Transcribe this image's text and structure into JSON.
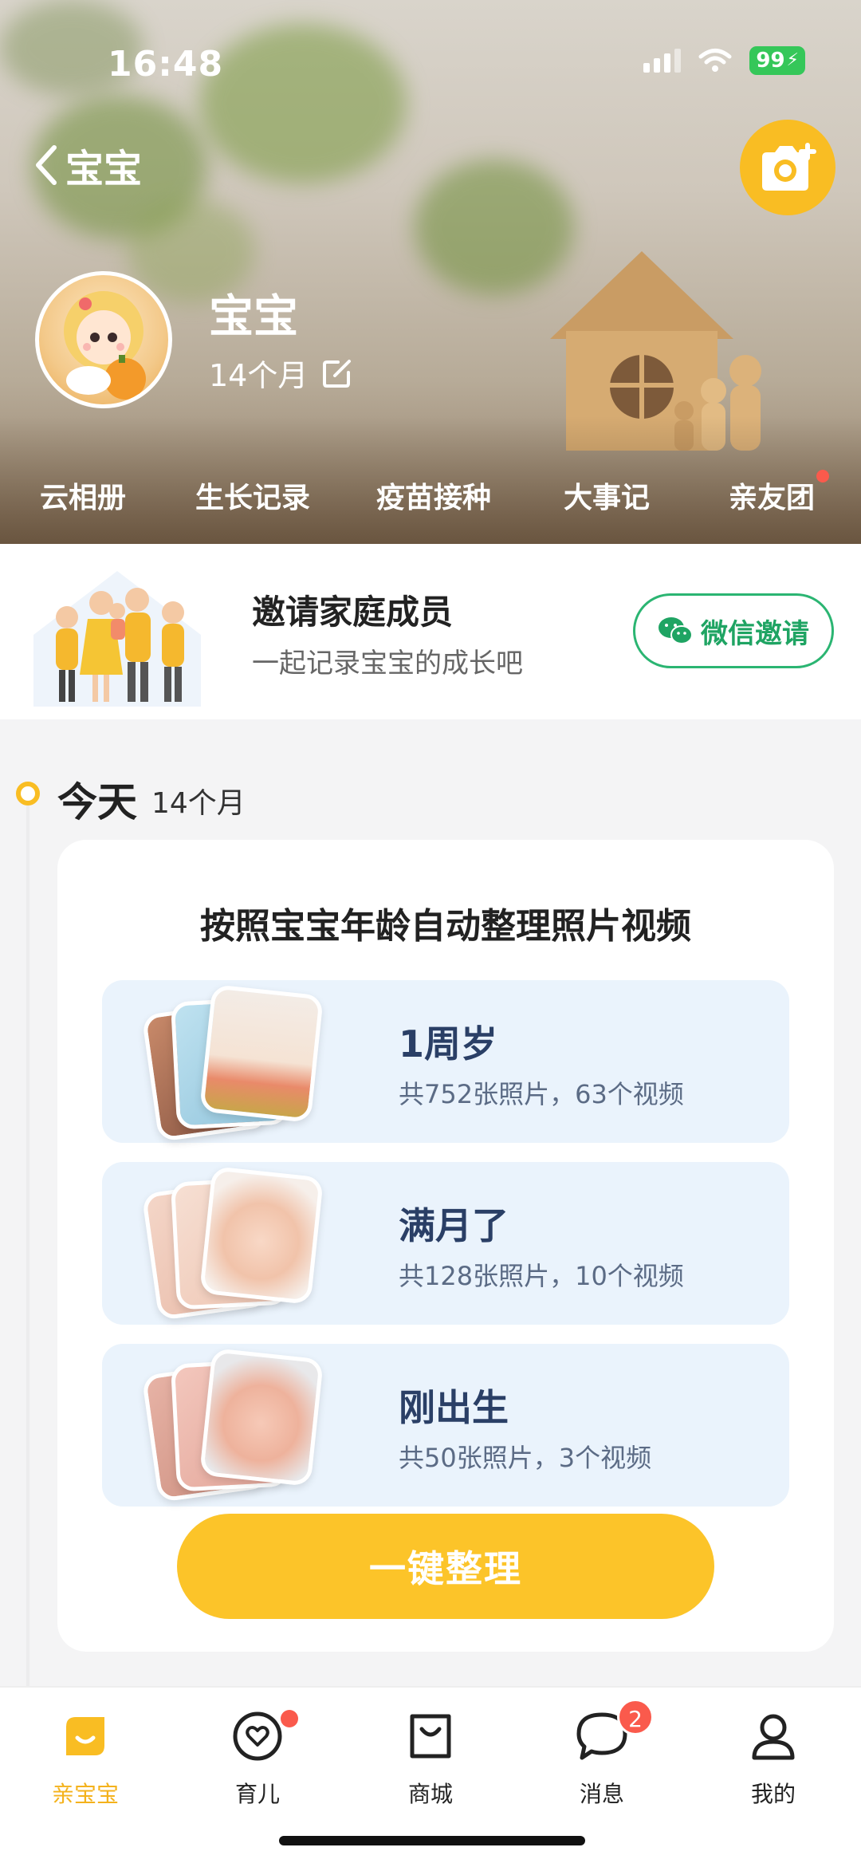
{
  "status_bar": {
    "time": "16:48",
    "battery": "99"
  },
  "header": {
    "back_label": "宝宝"
  },
  "profile": {
    "name": "宝宝",
    "age": "14个月"
  },
  "tabs": [
    "云相册",
    "生长记录",
    "疫苗接种",
    "大事记",
    "亲友团"
  ],
  "invite": {
    "title": "邀请家庭成员",
    "subtitle": "一起记录宝宝的成长吧",
    "button": "微信邀请"
  },
  "timeline": {
    "today_label": "今天",
    "today_age": "14个月",
    "card_title": "按照宝宝年龄自动整理照片视频",
    "groups": [
      {
        "name": "1周岁",
        "stats": "共752张照片，63个视频"
      },
      {
        "name": "满月了",
        "stats": "共128张照片，10个视频"
      },
      {
        "name": "刚出生",
        "stats": "共50张照片，3个视频"
      }
    ],
    "organize_button": "一键整理"
  },
  "bottom_nav": [
    {
      "label": "亲宝宝",
      "icon": "home-face-icon",
      "active": true
    },
    {
      "label": "育儿",
      "icon": "heart-icon",
      "dot": true
    },
    {
      "label": "商城",
      "icon": "shopping-bag-icon"
    },
    {
      "label": "消息",
      "icon": "chat-bubble-icon",
      "badge": "2"
    },
    {
      "label": "我的",
      "icon": "person-icon"
    }
  ],
  "colors": {
    "accent": "#f9bd23",
    "wechat": "#2bb572",
    "badge": "#fa5a4c"
  }
}
